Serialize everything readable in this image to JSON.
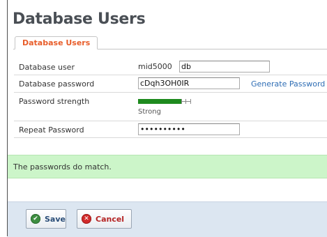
{
  "page": {
    "title": "Database Users"
  },
  "tabs": [
    {
      "label": "Database Users",
      "active": true
    }
  ],
  "form": {
    "user": {
      "label": "Database user",
      "prefix": "mid5000",
      "value": "db"
    },
    "password": {
      "label": "Database password",
      "value": "cDqh3OH0IR",
      "generate_label": "Generate Password"
    },
    "strength": {
      "label": "Password strength",
      "text": "Strong",
      "level": 0.88
    },
    "repeat": {
      "label": "Repeat Password",
      "value": "••••••••••"
    }
  },
  "message": {
    "text": "The passwords do match."
  },
  "actions": {
    "save": {
      "label": "Save",
      "icon": "check-circle-icon"
    },
    "cancel": {
      "label": "Cancel",
      "icon": "x-circle-icon"
    }
  },
  "colors": {
    "tab_text": "#e85d2a",
    "link": "#2e6db4",
    "strength_bar": "#1e8a1e",
    "success_bg": "#ccf5c9",
    "footer_bg": "#dce6f1"
  }
}
